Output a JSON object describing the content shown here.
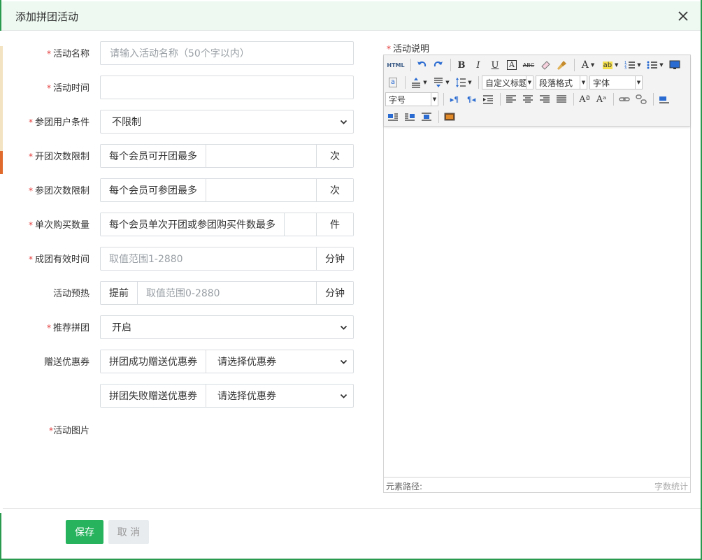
{
  "dialog": {
    "title": "添加拼团活动"
  },
  "form": {
    "name": {
      "label": "活动名称",
      "placeholder": "请输入活动名称（50个字以内）"
    },
    "time": {
      "label": "活动时间"
    },
    "user_condition": {
      "label": "参团用户条件",
      "value": "不限制"
    },
    "open_limit": {
      "label": "开团次数限制",
      "prefix": "每个会员可开团最多",
      "suffix": "次"
    },
    "join_limit": {
      "label": "参团次数限制",
      "prefix": "每个会员可参团最多",
      "suffix": "次"
    },
    "buy_limit": {
      "label": "单次购买数量",
      "prefix": "每个会员单次开团或参团购买件数最多",
      "suffix": "件"
    },
    "valid_time": {
      "label": "成团有效时间",
      "placeholder": "取值范围1-2880",
      "suffix": "分钟"
    },
    "preheat": {
      "label": "活动预热",
      "prefix": "提前",
      "placeholder": "取值范围0-2880",
      "suffix": "分钟"
    },
    "recommend": {
      "label": "推荐拼团",
      "value": "开启"
    },
    "coupon": {
      "label": "赠送优惠券",
      "success_prefix": "拼团成功赠送优惠券",
      "success_value": "请选择优惠券",
      "fail_prefix": "拼团失败赠送优惠券",
      "fail_value": "请选择优惠券"
    },
    "image": {
      "label": "活动图片"
    },
    "required_mark": "*"
  },
  "editor": {
    "label": "活动说明",
    "html_button": "HTML",
    "custom_title": "自定义标题",
    "paragraph": "段落格式",
    "font": "字体",
    "font_size": "字号",
    "path_label": "元素路径:",
    "word_count": "字数统计"
  },
  "buttons": {
    "save": "保存",
    "cancel": "取 消"
  },
  "colors": {
    "primary": "#27b35e",
    "header_bg": "#edf9f1",
    "required": "#e43b3b"
  }
}
